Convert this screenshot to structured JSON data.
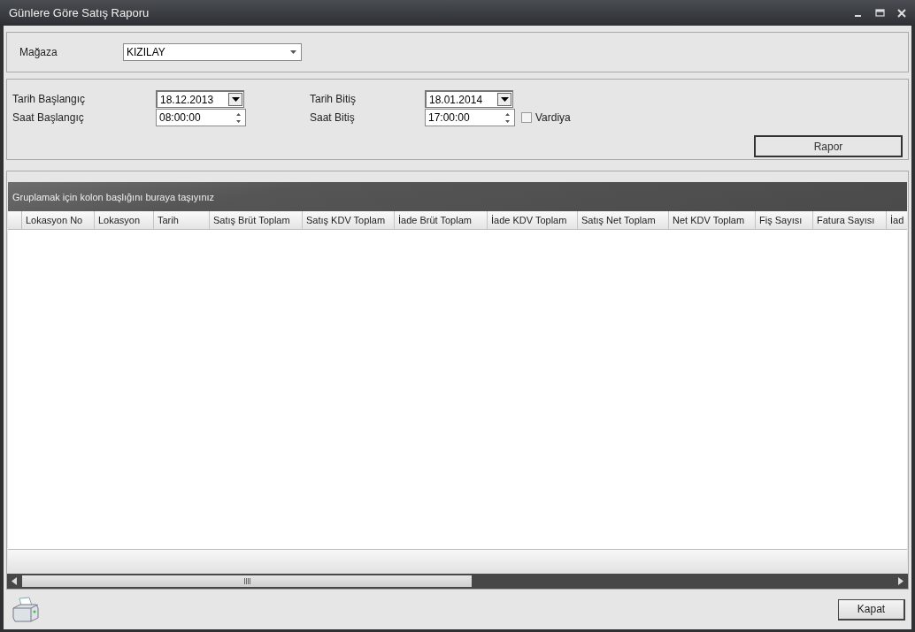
{
  "window": {
    "title": "Günlere Göre Satış Raporu"
  },
  "store": {
    "label": "Mağaza",
    "value": "KIZILAY"
  },
  "filters": {
    "start_date_label": "Tarih Başlangıç",
    "start_date": "18.12.2013",
    "start_time_label": "Saat Başlangıç",
    "start_time": "08:00:00",
    "end_date_label": "Tarih Bitiş",
    "end_date": "18.01.2014",
    "end_time_label": "Saat Bitiş",
    "end_time": "17:00:00",
    "shift": {
      "label": "Vardiya",
      "checked": false
    },
    "report_button": "Rapor"
  },
  "grid": {
    "group_hint": "Gruplamak için kolon başlığını buraya taşıyınız",
    "columns": [
      {
        "label": "Lokasyon No"
      },
      {
        "label": "Lokasyon"
      },
      {
        "label": "Tarih"
      },
      {
        "label": "Satış Brüt Toplam"
      },
      {
        "label": "Satış KDV Toplam"
      },
      {
        "label": "İade Brüt Toplam"
      },
      {
        "label": "İade KDV Toplam"
      },
      {
        "label": "Satış Net Toplam"
      },
      {
        "label": "Net KDV Toplam"
      },
      {
        "label": "Fiş Sayısı"
      },
      {
        "label": "Fatura Sayısı"
      },
      {
        "label": "İad"
      }
    ]
  },
  "footer": {
    "close_button": "Kapat"
  }
}
